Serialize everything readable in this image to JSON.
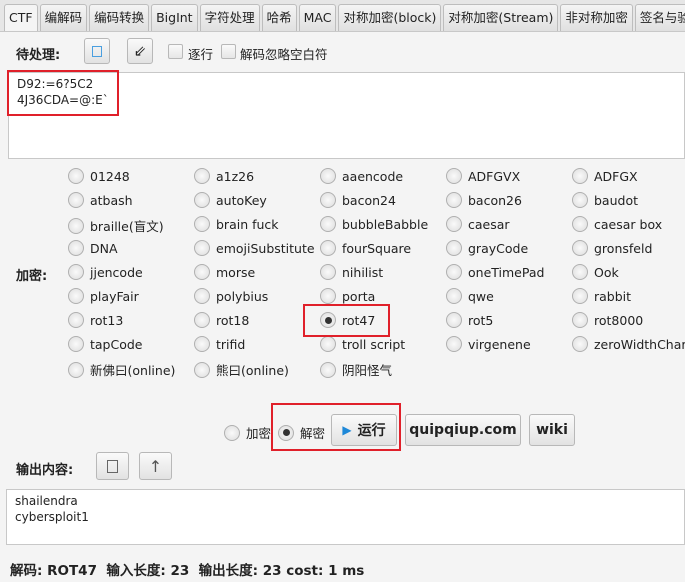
{
  "tabs": [
    "CTF",
    "编解码",
    "编码转换",
    "BigInt",
    "字符处理",
    "哈希",
    "MAC",
    "对称加密(block)",
    "对称加密(Stream)",
    "非对称加密",
    "签名与验签"
  ],
  "input": {
    "label": "待处理:",
    "line_by_line": "逐行",
    "ignore_whitespace": "解码忽略空白符",
    "lines": [
      "D92:=6?5C2",
      "4J36CDA=@:E`"
    ]
  },
  "encrypt_label": "加密:",
  "algorithms": [
    "01248",
    "a1z26",
    "aaencode",
    "ADFGVX",
    "ADFGX",
    "atbash",
    "autoKey",
    "bacon24",
    "bacon26",
    "baudot",
    "braille(盲文)",
    "brain fuck",
    "bubbleBabble",
    "caesar",
    "caesar box",
    "DNA",
    "emojiSubstitute",
    "fourSquare",
    "grayCode",
    "gronsfeld",
    "jjencode",
    "morse",
    "nihilist",
    "oneTimePad",
    "Ook",
    "playFair",
    "polybius",
    "porta",
    "qwe",
    "rabbit",
    "rot13",
    "rot18",
    "rot47",
    "rot5",
    "rot8000",
    "tapCode",
    "trifid",
    "troll script",
    "virgenene",
    "zeroWidthChar",
    "新佛曰(online)",
    "熊曰(online)",
    "阴阳怪气"
  ],
  "selected_algorithm": "rot47",
  "mode": {
    "encrypt": "加密",
    "decrypt": "解密",
    "selected": "decrypt"
  },
  "buttons": {
    "run": "运行",
    "quipqiup": "quipqiup.com",
    "wiki": "wiki"
  },
  "output": {
    "label": "输出内容:",
    "lines": [
      "shailendra",
      "cybersploit1"
    ]
  },
  "status": "解码: ROT47  输入长度: 23  输出长度: 23 cost: 1 ms",
  "colors": {
    "highlight": "#e0202a",
    "run_icon": "#1e88d8"
  }
}
